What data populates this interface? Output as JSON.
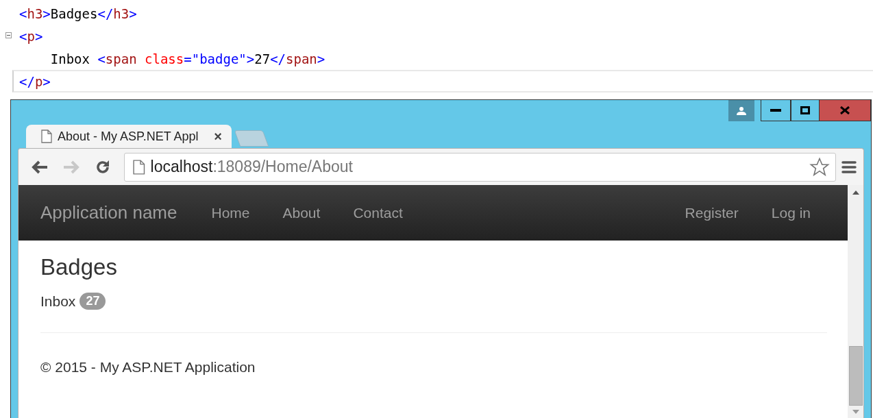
{
  "code_editor": {
    "lines": [
      {
        "foldable": false,
        "current": false,
        "tokens": [
          {
            "kind": "delim",
            "text": "<"
          },
          {
            "kind": "element",
            "text": "h3"
          },
          {
            "kind": "delim",
            "text": ">"
          },
          {
            "kind": "text",
            "text": "Badges"
          },
          {
            "kind": "delim",
            "text": "</"
          },
          {
            "kind": "element",
            "text": "h3"
          },
          {
            "kind": "delim",
            "text": ">"
          }
        ]
      },
      {
        "foldable": true,
        "current": false,
        "tokens": [
          {
            "kind": "delim",
            "text": "<"
          },
          {
            "kind": "element",
            "text": "p"
          },
          {
            "kind": "delim",
            "text": ">"
          }
        ]
      },
      {
        "foldable": false,
        "current": false,
        "tokens": [
          {
            "kind": "text",
            "text": "    Inbox "
          },
          {
            "kind": "delim",
            "text": "<"
          },
          {
            "kind": "element",
            "text": "span"
          },
          {
            "kind": "attr",
            "text": " class"
          },
          {
            "kind": "delim",
            "text": "=\""
          },
          {
            "kind": "value",
            "text": "badge"
          },
          {
            "kind": "delim",
            "text": "\">"
          },
          {
            "kind": "text",
            "text": "27"
          },
          {
            "kind": "delim",
            "text": "</"
          },
          {
            "kind": "element",
            "text": "span"
          },
          {
            "kind": "delim",
            "text": ">"
          }
        ]
      },
      {
        "foldable": false,
        "current": true,
        "tokens": [
          {
            "kind": "delim",
            "text": "</"
          },
          {
            "kind": "element",
            "text": "p"
          },
          {
            "kind": "delim",
            "text": ">"
          }
        ]
      }
    ]
  },
  "browser": {
    "tabs": [
      {
        "title": "About - My ASP.NET Appl",
        "close": "×",
        "selected": true
      }
    ],
    "nav_buttons": [
      {
        "kind": "back",
        "disabled": false
      },
      {
        "kind": "forward",
        "disabled": true
      },
      {
        "kind": "reload",
        "disabled": false
      }
    ],
    "address": {
      "host": "localhost",
      "path": ":18089/Home/About"
    },
    "page": {
      "navbar": {
        "brand": "Application name",
        "links": [
          "Home",
          "About",
          "Contact"
        ],
        "right_links": [
          "Register",
          "Log in"
        ]
      },
      "heading": "Badges",
      "inbox": {
        "label": "Inbox",
        "badge": "27"
      },
      "footer": "© 2015 - My ASP.NET Application"
    }
  }
}
